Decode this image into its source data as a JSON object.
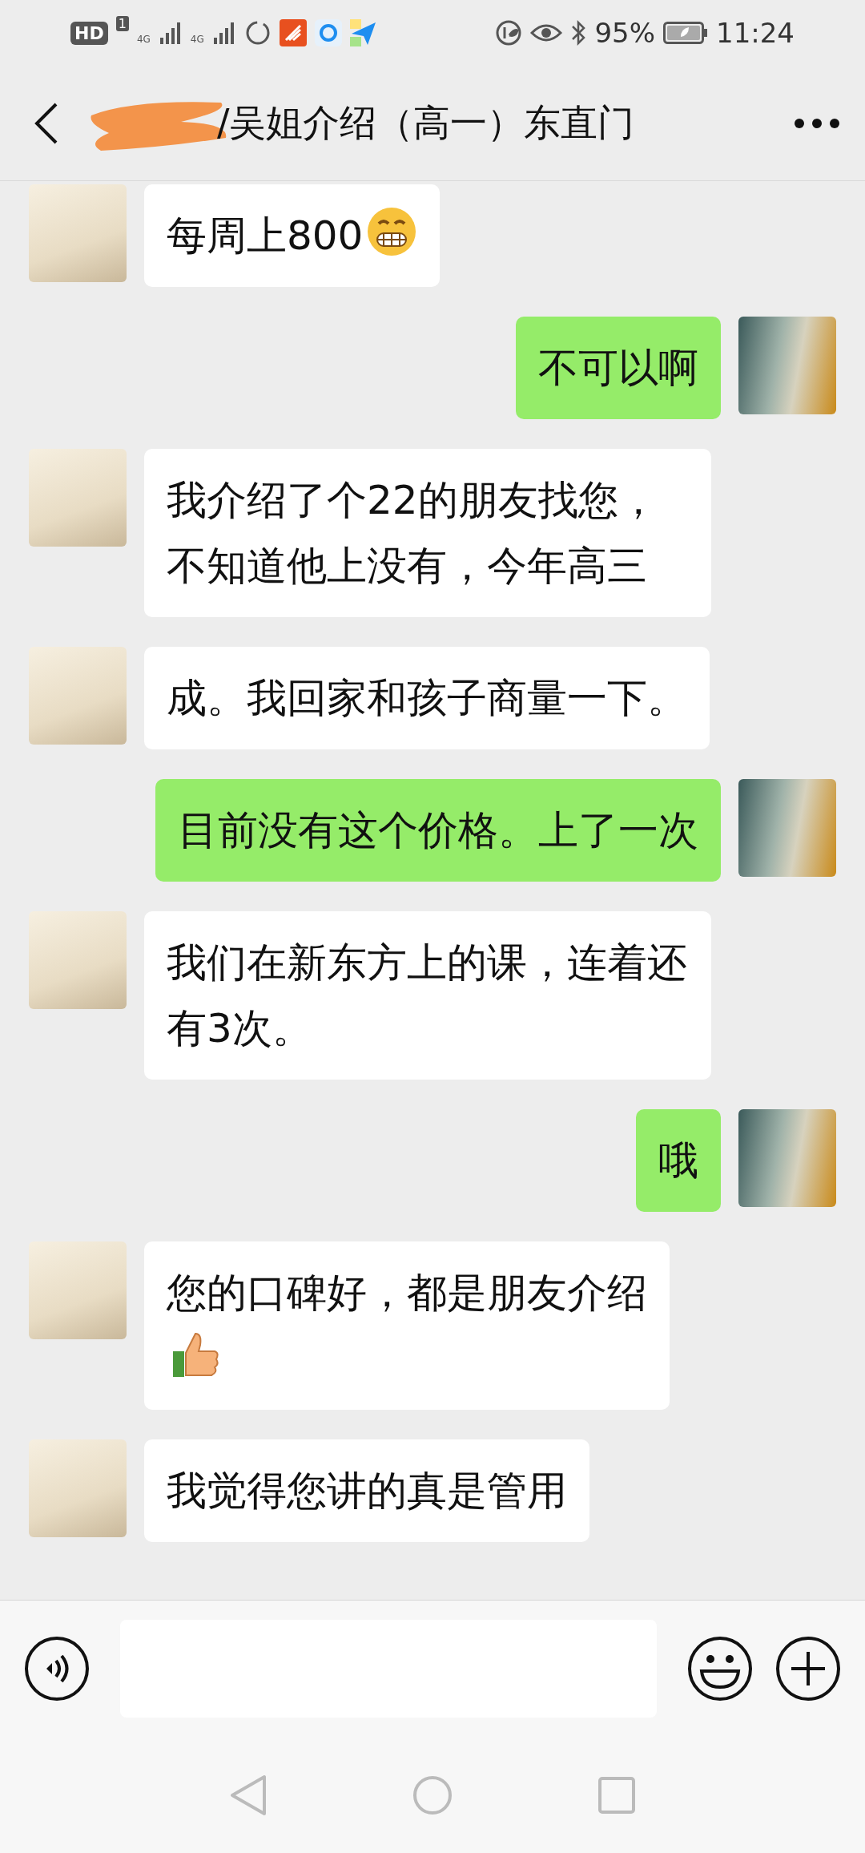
{
  "status_bar": {
    "hd": "HD",
    "sim_slot": "1",
    "network_1": "4G",
    "network_2": "4G",
    "battery": "95%",
    "time": "11:24"
  },
  "header": {
    "title": "/吴姐介绍（高一）东直门",
    "redacted": true
  },
  "messages": [
    {
      "kind": "incoming",
      "text": "每周上800",
      "emoji": {
        "kind": "grimace"
      }
    },
    {
      "kind": "outgoing",
      "text": "不可以啊"
    },
    {
      "kind": "incoming",
      "text": "我介绍了个22的朋友找您，不知道他上没有，今年高三"
    },
    {
      "kind": "incoming",
      "text": "成。我回家和孩子商量一下。"
    },
    {
      "kind": "outgoing",
      "text": "目前没有这个价格。上了一次"
    },
    {
      "kind": "incoming",
      "text": "我们在新东方上的课，连着还有3次。"
    },
    {
      "kind": "outgoing",
      "text": "哦"
    },
    {
      "kind": "incoming",
      "text": "您的口碑好，都是朋友介绍",
      "emoji": {
        "kind": "thumbs_up"
      }
    },
    {
      "kind": "incoming",
      "text": "我觉得您讲的真是管用"
    }
  ],
  "input_bar": {
    "voice": true
  }
}
